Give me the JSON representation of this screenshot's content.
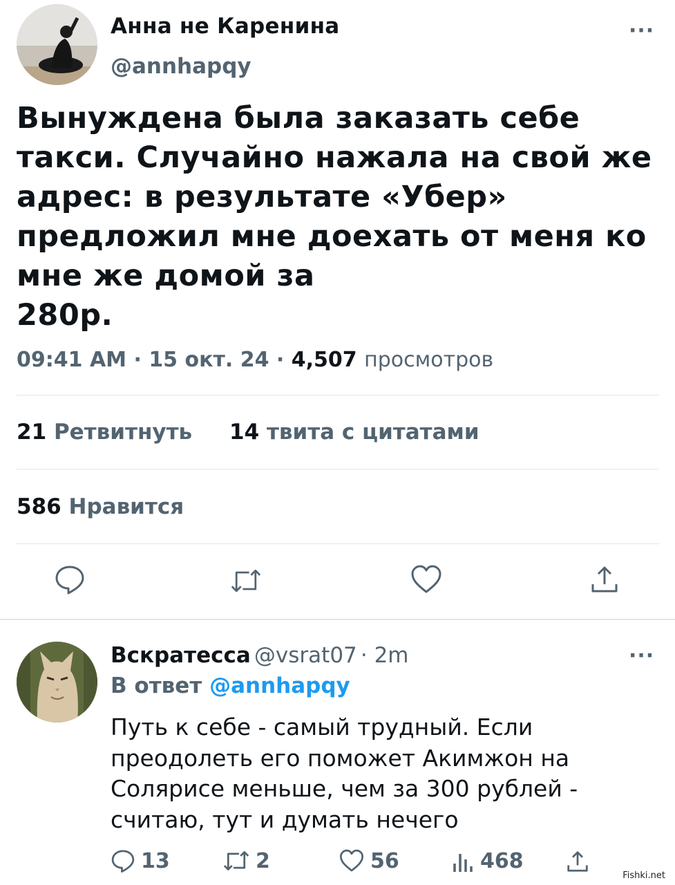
{
  "tweet": {
    "author_name": "Анна не Каренина",
    "author_handle": "@annhapqy",
    "more_label": "···",
    "text_lines": [
      "Вынуждена была заказать себе",
      "такси. Случайно нажала на свой же",
      "адрес: в результате «Убер»",
      "предложил мне доехать от меня ко",
      "мне же домой за",
      "280р."
    ],
    "time": "09:41 AM",
    "date": "15 окт. 24",
    "views_count": "4,507",
    "views_label": "просмотров",
    "retweets_count": "21",
    "retweets_label": "Ретвитнуть",
    "quotes_count": "14",
    "quotes_label": "твита с цитатами",
    "likes_count": "586",
    "likes_label": "Нравится",
    "actions": [
      "reply-icon",
      "retweet-icon",
      "heart-icon",
      "share-icon"
    ]
  },
  "reply": {
    "author_name": "Вскратесса",
    "author_handle": "@vsrat07",
    "time": "2m",
    "more_label": "···",
    "reply_to_prefix": "В ответ",
    "reply_to_mention": "@annhapqy",
    "text_lines": [
      "Путь к себе - самый трудный. Если",
      "преодолеть его поможет Акимжон на",
      "Солярисе меньше, чем за 300 рублей -",
      "считаю, тут и думать нечего"
    ],
    "replies_count": "13",
    "retweets_count": "2",
    "likes_count": "56",
    "views_count": "468"
  },
  "watermark": "Fishki.net",
  "colors": {
    "text": "#0f1419",
    "secondary": "#536471",
    "accent": "#1d9bf0",
    "divider": "#e1e6ea"
  }
}
